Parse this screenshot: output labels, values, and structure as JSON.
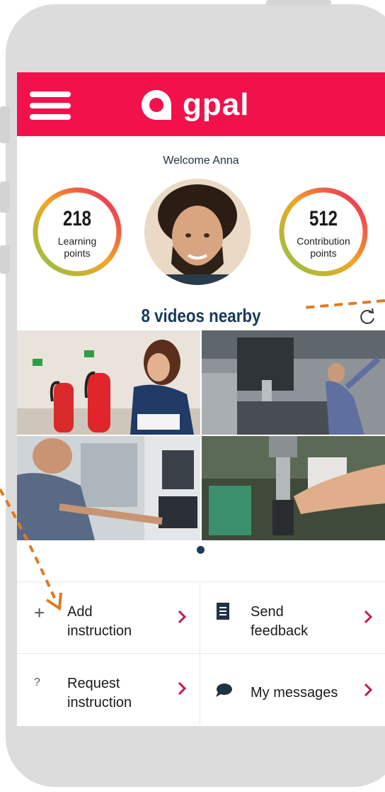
{
  "header": {
    "brand": "gpal",
    "menu_icon": "hamburger-menu-icon",
    "color": "#f2114b"
  },
  "profile": {
    "welcome": "Welcome Anna",
    "learning_points": "218",
    "learning_label_1": "Learning",
    "learning_label_2": "points",
    "contribution_points": "512",
    "contribution_label_1": "Contribution",
    "contribution_label_2": "points"
  },
  "videos": {
    "title": "8 videos nearby",
    "refresh_icon": "refresh-icon",
    "thumbnails": [
      "fire-extinguisher-inspection",
      "cnc-machine-operator",
      "machine-control-panel",
      "drill-press-handling"
    ],
    "page_indicator": "1"
  },
  "actions": {
    "add": {
      "line1": "Add",
      "line2": "instruction",
      "icon": "plus-icon"
    },
    "feedback": {
      "line1": "Send",
      "line2": "feedback",
      "icon": "book-icon"
    },
    "request": {
      "line1": "Request",
      "line2": "instruction",
      "icon": "question-icon"
    },
    "messages": {
      "line1": "My messages",
      "icon": "chat-bubble-icon"
    },
    "chevron_color": "#c2185b"
  },
  "annotation": {
    "arrow_color": "#e07a22"
  }
}
